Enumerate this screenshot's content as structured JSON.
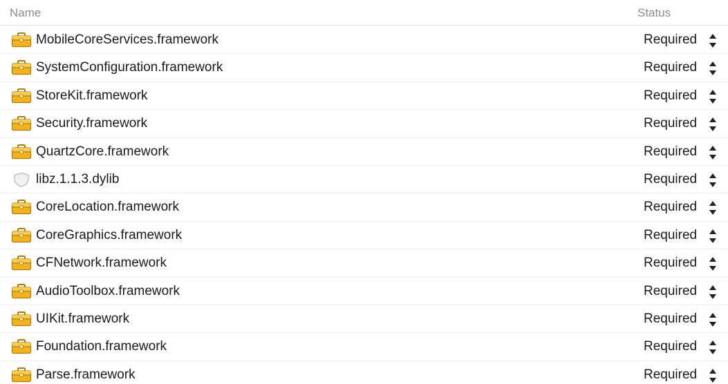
{
  "header": {
    "name_label": "Name",
    "status_label": "Status"
  },
  "rows": [
    {
      "name": "MobileCoreServices.framework",
      "status": "Required",
      "icon": "toolbox-icon"
    },
    {
      "name": "SystemConfiguration.framework",
      "status": "Required",
      "icon": "toolbox-icon"
    },
    {
      "name": "StoreKit.framework",
      "status": "Required",
      "icon": "toolbox-icon"
    },
    {
      "name": "Security.framework",
      "status": "Required",
      "icon": "toolbox-icon"
    },
    {
      "name": "QuartzCore.framework",
      "status": "Required",
      "icon": "toolbox-icon"
    },
    {
      "name": "libz.1.1.3.dylib",
      "status": "Required",
      "icon": "library-shield-icon"
    },
    {
      "name": "CoreLocation.framework",
      "status": "Required",
      "icon": "toolbox-icon"
    },
    {
      "name": "CoreGraphics.framework",
      "status": "Required",
      "icon": "toolbox-icon"
    },
    {
      "name": "CFNetwork.framework",
      "status": "Required",
      "icon": "toolbox-icon"
    },
    {
      "name": "AudioToolbox.framework",
      "status": "Required",
      "icon": "toolbox-icon"
    },
    {
      "name": "UIKit.framework",
      "status": "Required",
      "icon": "toolbox-icon"
    },
    {
      "name": "Foundation.framework",
      "status": "Required",
      "icon": "toolbox-icon"
    },
    {
      "name": "Parse.framework",
      "status": "Required",
      "icon": "toolbox-icon"
    }
  ],
  "colors": {
    "toolbox_body": "#f2b31d",
    "toolbox_dark": "#b07b0a",
    "shield_fill": "#f1f1f1",
    "shield_stroke": "#b8b8b8"
  }
}
